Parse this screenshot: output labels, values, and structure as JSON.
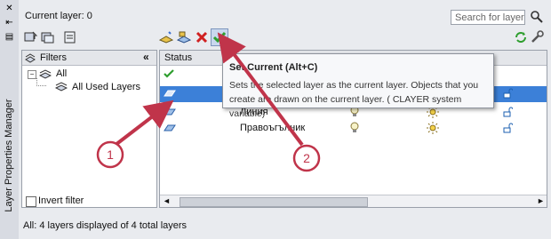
{
  "palette": {
    "title": "Layer Properties Manager"
  },
  "header": {
    "current_layer": "Current layer: 0",
    "search_placeholder": "Search for layer"
  },
  "filters": {
    "header": "Filters",
    "tree_all": "All",
    "tree_all_used": "All Used Layers",
    "invert_filter": "Invert filter"
  },
  "list": {
    "status_header": "Status",
    "rows": [
      {
        "name": ""
      },
      {
        "name": ""
      },
      {
        "name": "Линия"
      },
      {
        "name": "Правоъгълник"
      }
    ]
  },
  "tooltip": {
    "title": "Set Current (Alt+C)",
    "body": "Sets the selected layer as the current layer. Objects that you create are drawn on the current layer. ( CLAYER system variable)"
  },
  "annotations": {
    "marker1": "1",
    "marker2": "2"
  },
  "status_bar": "All: 4 layers displayed of 4 total layers",
  "colors": {
    "annotation_red": "#c0344a",
    "selection_blue": "#3c80d8",
    "set_current_green": "#2e9e2e"
  }
}
